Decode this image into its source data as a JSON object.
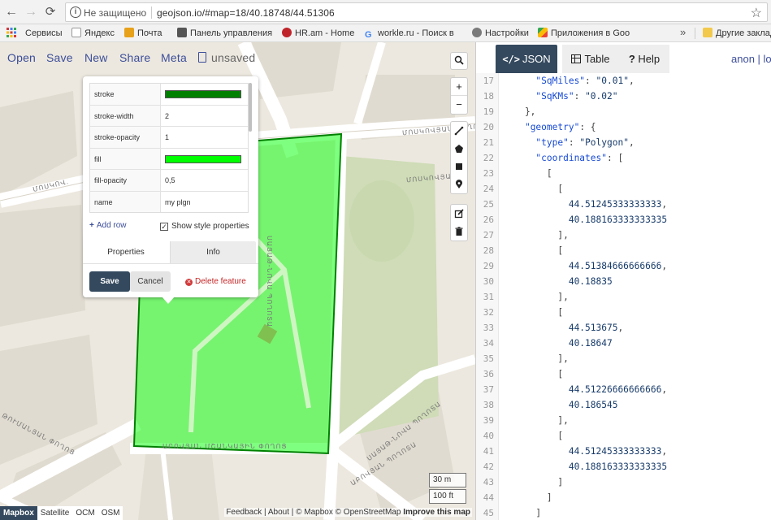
{
  "browser": {
    "security_label": "Не защищено",
    "url": "geojson.io/#map=18/40.18748/44.51306",
    "back_icon": "←",
    "forward_icon": "→",
    "reload_icon": "⟳",
    "star_icon": "☆"
  },
  "bookmarks": [
    {
      "label": "Сервисы",
      "color": "#d23a3a"
    },
    {
      "label": "Яндекс",
      "color": "#bbbbbb"
    },
    {
      "label": "Почта",
      "color": "#e8a11a"
    },
    {
      "label": "Панель управления",
      "color": "#555555"
    },
    {
      "label": "HR.am - Home",
      "color": "#c0242b"
    },
    {
      "label": "workle.ru - Поиск в",
      "color": "#4285f4"
    },
    {
      "label": "Настройки",
      "color": "#7a7a7a"
    },
    {
      "label": "Приложения в Goo",
      "color": "#34a853"
    },
    {
      "label": "Другие заклад",
      "color": "#f2c94c"
    }
  ],
  "bookmarks_more": "»",
  "toolbar": {
    "open": "Open",
    "save": "Save",
    "new": "New",
    "share": "Share",
    "meta": "Meta",
    "unsaved": "unsaved"
  },
  "map_labels": {
    "street_top_right": "ՄՈՍԿՈՎՅԱՆ ՓՈՂՈՑ",
    "street_top_right2": "ՄՈՍԿՈՎՅԱՆ Փ.",
    "street_left": "ՄՈՍԿՈՎ.",
    "street_right_vertical": "ՍԱՅԱԹ-ՆՈՎԱ ՊՈՂՈՏԱ",
    "street_bottom": "ԱԲՈՎՅԱՆ ՄՇԱՆԿԱՅԻՆ ՓՈՂՈՑ",
    "street_bottom_left": "ԹՈՒՄԱՆՅԱՆ ՓՈՂՈՑ",
    "street_bottom_right": "ՍԱՅԱԹ-ՆՈՎԱ ՊՈՂՈՏԱ",
    "street_bottom_right2": "ԱԲՈՎՅԱՆ ՊՈՂՈՏԱ"
  },
  "properties": {
    "rows": [
      {
        "key": "stroke",
        "value": "",
        "swatch": "#008000"
      },
      {
        "key": "stroke-width",
        "value": "2",
        "swatch": null
      },
      {
        "key": "stroke-opacity",
        "value": "1",
        "swatch": null
      },
      {
        "key": "fill",
        "value": "",
        "swatch": "#00ff00"
      },
      {
        "key": "fill-opacity",
        "value": "0,5",
        "swatch": null
      },
      {
        "key": "name",
        "value": "my plgn",
        "swatch": null
      }
    ],
    "add_row": "Add row",
    "show_style": "Show style properties",
    "show_style_checked": true,
    "tabs": {
      "properties": "Properties",
      "info": "Info"
    },
    "save": "Save",
    "cancel": "Cancel",
    "delete": "Delete feature"
  },
  "controls": {
    "search_icon": "search-icon",
    "zoom_in": "+",
    "zoom_out": "−"
  },
  "scale": {
    "metric": "30 m",
    "imperial": "100 ft"
  },
  "layers": [
    "Mapbox",
    "Satellite",
    "OCM",
    "OSM"
  ],
  "active_layer": "Mapbox",
  "attribution": {
    "feedback": "Feedback",
    "about": "About",
    "mapbox": "© Mapbox",
    "osm": "© OpenStreetMap",
    "improve": "Improve this map"
  },
  "panel": {
    "tab_json": "JSON",
    "tab_table": "Table",
    "tab_help": "Help",
    "user": "anon | lo"
  },
  "code_lines": [
    {
      "n": "17",
      "text": "      \"SqMiles\": \"0.01\","
    },
    {
      "n": "18",
      "text": "      \"SqKMs\": \"0.02\""
    },
    {
      "n": "19",
      "text": "    },"
    },
    {
      "n": "20",
      "text": "    \"geometry\": {"
    },
    {
      "n": "21",
      "text": "      \"type\": \"Polygon\","
    },
    {
      "n": "22",
      "text": "      \"coordinates\": ["
    },
    {
      "n": "23",
      "text": "        ["
    },
    {
      "n": "24",
      "text": "          ["
    },
    {
      "n": "25",
      "text": "            44.51245333333333,"
    },
    {
      "n": "26",
      "text": "            40.188163333333335"
    },
    {
      "n": "27",
      "text": "          ],"
    },
    {
      "n": "28",
      "text": "          ["
    },
    {
      "n": "29",
      "text": "            44.51384666666666,"
    },
    {
      "n": "30",
      "text": "            40.18835"
    },
    {
      "n": "31",
      "text": "          ],"
    },
    {
      "n": "32",
      "text": "          ["
    },
    {
      "n": "33",
      "text": "            44.513675,"
    },
    {
      "n": "34",
      "text": "            40.18647"
    },
    {
      "n": "35",
      "text": "          ],"
    },
    {
      "n": "36",
      "text": "          ["
    },
    {
      "n": "37",
      "text": "            44.51226666666666,"
    },
    {
      "n": "38",
      "text": "            40.186545"
    },
    {
      "n": "39",
      "text": "          ],"
    },
    {
      "n": "40",
      "text": "          ["
    },
    {
      "n": "41",
      "text": "            44.51245333333333,"
    },
    {
      "n": "42",
      "text": "            40.188163333333335"
    },
    {
      "n": "43",
      "text": "          ]"
    },
    {
      "n": "44",
      "text": "        ]"
    },
    {
      "n": "45",
      "text": "      ]"
    }
  ]
}
